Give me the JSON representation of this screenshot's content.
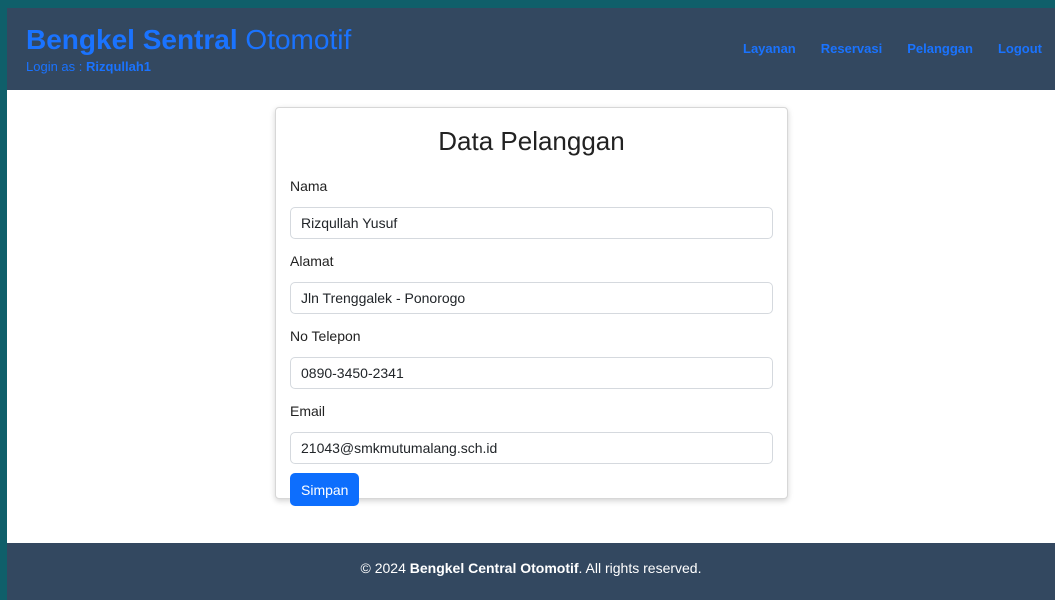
{
  "header": {
    "brand_bold": "Bengkel Sentral",
    "brand_light": "Otomotif",
    "login_prefix": "Login as :",
    "login_user": "Rizqullah1",
    "nav": [
      "Layanan",
      "Reservasi",
      "Pelanggan",
      "Logout"
    ]
  },
  "form": {
    "title": "Data Pelanggan",
    "fields": [
      {
        "label": "Nama",
        "value": "Rizqullah Yusuf"
      },
      {
        "label": "Alamat",
        "value": "Jln Trenggalek - Ponorogo"
      },
      {
        "label": "No Telepon",
        "value": "0890-3450-2341"
      },
      {
        "label": "Email",
        "value": "21043@smkmutumalang.sch.id"
      }
    ],
    "submit_label": "Simpan"
  },
  "footer": {
    "prefix": "© 2024",
    "brand": "Bengkel Central Otomotif",
    "suffix": ". All rights reserved."
  },
  "colors": {
    "navbar": "#334860",
    "accent": "#1a73ff",
    "button": "#0d6efd",
    "outer_background": "#0f5f6a"
  }
}
